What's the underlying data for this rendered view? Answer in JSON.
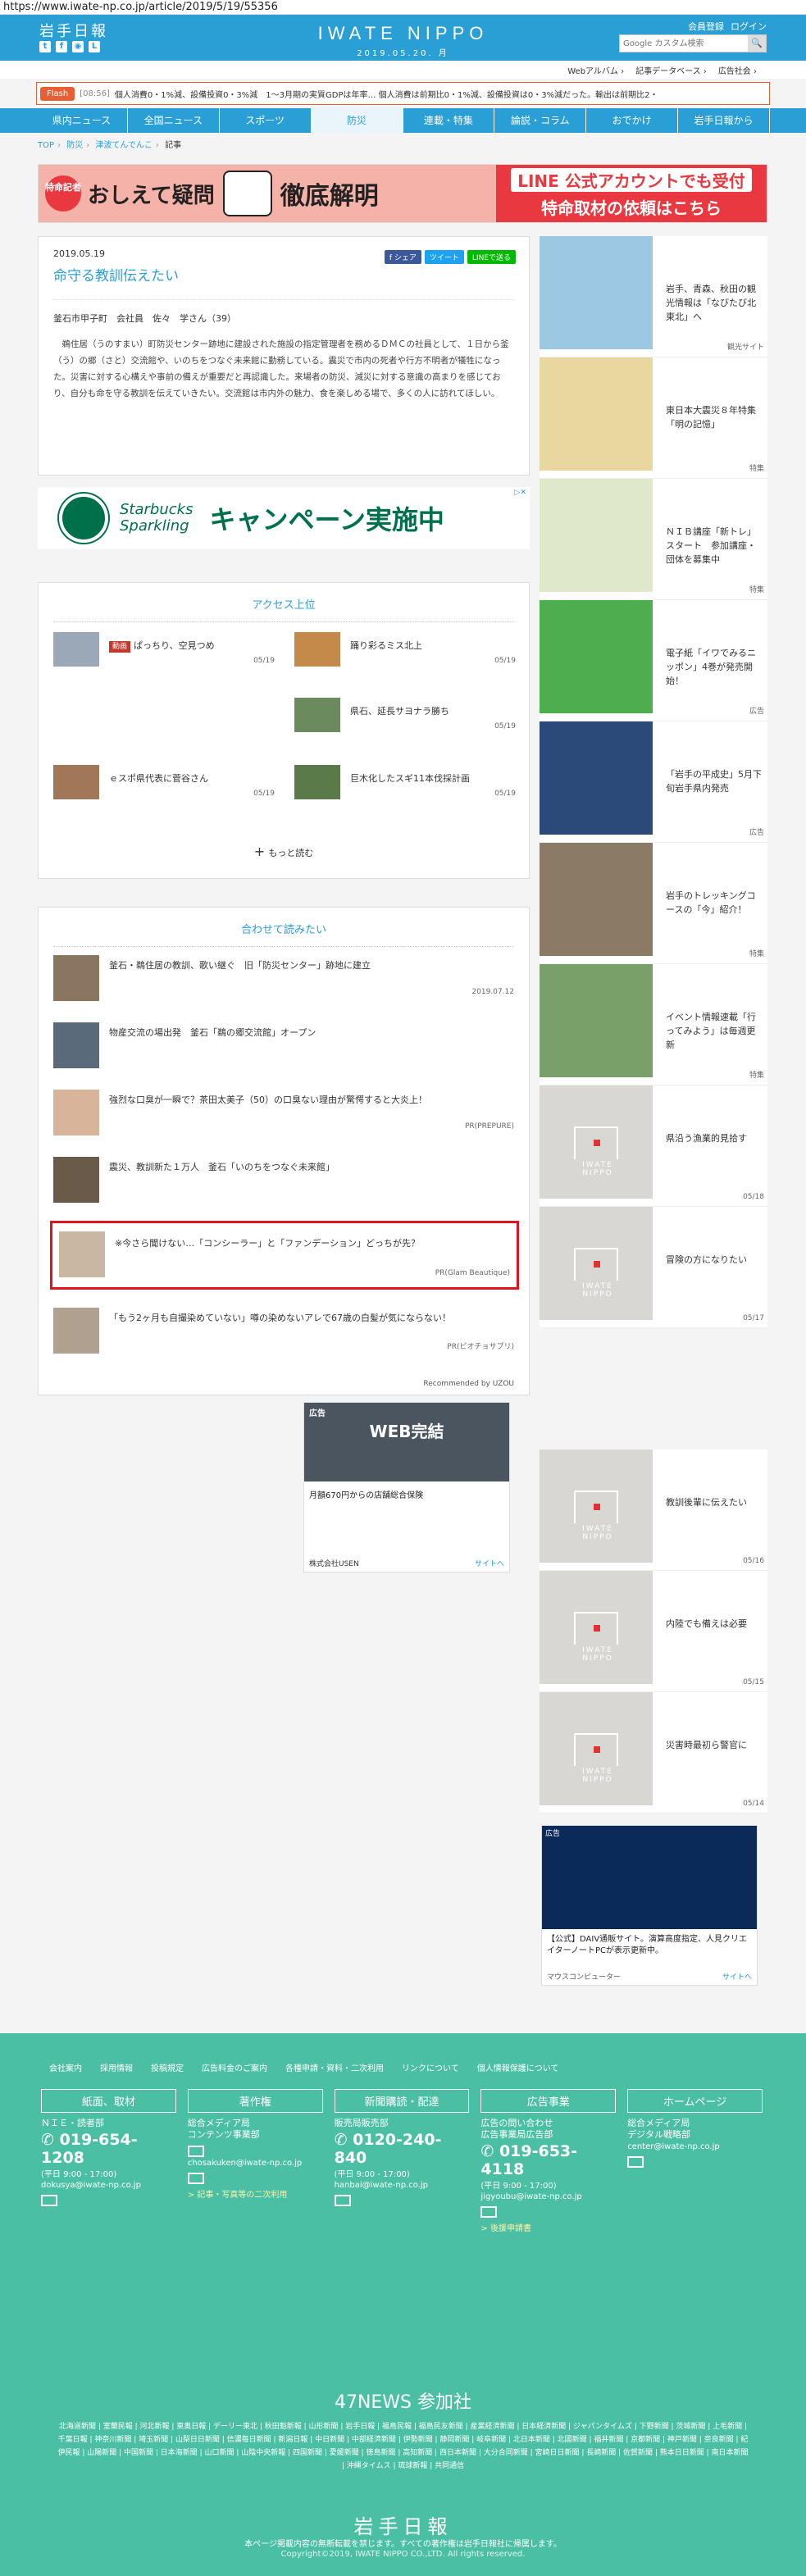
{
  "url": "https://www.iwate-np.co.jp/article/2019/5/19/55356",
  "header": {
    "logo_small": "岩手日報",
    "brand": "IWATE NIPPO",
    "date": "2019.05.20. 月",
    "register": "会員登録",
    "login": "ログイン",
    "search_placeholder": "Google カスタム検索",
    "search_button": "🔍",
    "sublinks": [
      "Webアルバム ›",
      "記事データベース ›",
      "広告社会 ›"
    ]
  },
  "flash": {
    "tag": "Flash",
    "time": "[08:56]",
    "text": "個人消費0・1%減、設備投資0・3%減　1〜3月期の実質GDPは年率… 個人消費は前期比0・1%減、設備投資は0・3%減だった。輸出は前期比2・"
  },
  "nav": [
    "県内ニュース",
    "全国ニュース",
    "スポーツ",
    "防災",
    "連載・特集",
    "論説・コラム",
    "おでかけ",
    "岩手日報から"
  ],
  "breadcrumb": [
    "TOP",
    "防災",
    "津波てんでんこ",
    "記事"
  ],
  "banner": {
    "badge": "特命記者",
    "left_title": "おしえて疑問",
    "right_title": "徹底解明",
    "line1": "LINE 公式アカウントでも受付",
    "line2": "特命取材の依頼はこちら"
  },
  "article": {
    "date": "2019.05.19",
    "title": "命守る教訓伝えたい",
    "share": [
      "f シェア",
      "ツイート",
      "LINEで送る"
    ],
    "byline": "釜石市甲子町　会社員　佐々　学さん（39）",
    "body": "　鵜住居（うのすまい）町防災センター跡地に建設された施設の指定管理者を務めるＤＭＣの社員として、１日から釜（う）の郷（さと）交流館や、いのちをつなぐ未来館に勤務している。震災で市内の死者や行方不明者が犠牲になった。災害に対する心構えや事前の備えが重要だと再認識した。来場者の防災、減災に対する意識の高まりを感じており、自分も命を守る教訓を伝えていきたい。交流館は市内外の魅力、食を楽しめる場で、多くの人に訪れてほしい。"
  },
  "starbucks_ad": {
    "brand1": "Starbucks",
    "brand2": "Sparkling",
    "headline": "キャンペーン実施中",
    "ad_icon": "▷✕"
  },
  "access": {
    "title": "アクセス上位",
    "items": [
      {
        "tag": "動画",
        "text": "ぱっちり、空見つめ",
        "date": "05/19"
      },
      {
        "tag": "",
        "text": "踊り彩るミス北上",
        "date": "05/19"
      },
      {
        "tag": "",
        "text": "県石、延長サヨナラ勝ち",
        "date": "05/19"
      },
      {
        "tag": "",
        "text": "ｅスポ県代表に菅谷さん",
        "date": "05/19"
      },
      {
        "tag": "",
        "text": "巨木化したスギ11本伐採計画",
        "date": "05/19"
      }
    ],
    "more": "もっと読む"
  },
  "related": {
    "title": "合わせて読みたい",
    "items": [
      {
        "text": "釜石・鵜住居の教訓、歌い継ぐ　旧「防災センター」跡地に建立",
        "src": "2019.07.12"
      },
      {
        "text": "物産交流の場出発　釜石「鵜の郷交流館」オープン",
        "src": ""
      },
      {
        "text": "強烈な口臭が一瞬で？茶田太美子（50）の口臭ない理由が驚愕すると大炎上！",
        "src": "PR(PREPURE)"
      },
      {
        "text": "震災、教訓新た１万人　釜石「いのちをつなぐ未来館」",
        "src": ""
      },
      {
        "text": "※今さら聞けない…「コンシーラー」と「ファンデーション」どっちが先？",
        "src": "PR(Glam Beautique)"
      },
      {
        "text": "「もう2ヶ月も自撮染めていない」噂の染めないアレで67歳の白髪が気にならない！",
        "src": "PR(ビオチョサプリ)"
      }
    ],
    "powered": "Recommended by UZOU"
  },
  "usen_ad": {
    "ad_label": "広告",
    "headline": "WEB完結",
    "caption": "月額670円からの店舗総合保険",
    "company": "株式会社USEN",
    "site": "サイトへ"
  },
  "side": [
    {
      "text": "岩手、青森、秋田の観光情報は「なびたび北東北」へ",
      "meta": "観光サイト"
    },
    {
      "text": "東日本大震災８年特集「明の記憶」",
      "meta": "特集"
    },
    {
      "text": "ＮＩＢ講座「新トレ」スタート　参加講座・団体を募集中",
      "meta": "特集"
    },
    {
      "text": "電子紙「イワでみるニッポン」4巻が発売開始！",
      "meta": "広告"
    },
    {
      "text": "「岩手の平成史」5月下旬岩手県内発売",
      "meta": "広告"
    },
    {
      "text": "岩手のトレッキングコースの「今」紹介！",
      "meta": "特集"
    },
    {
      "text": "イベント情報速載「行ってみよう」は毎週更新",
      "meta": "特集"
    },
    {
      "text": "県沿う漁業的見拾す",
      "meta": "05/18"
    },
    {
      "text": "冒険の方になりたい",
      "meta": "05/17"
    },
    {
      "text": "教訓後輩に伝えたい",
      "meta": "05/16"
    },
    {
      "text": "内陸でも備えは必要",
      "meta": "05/15"
    },
    {
      "text": "災害時最初ら警官に",
      "meta": "05/14"
    }
  ],
  "placeholder_logo": "IWATE NIPPO",
  "mouse_ad": {
    "ad_label": "広告",
    "caption": "【公式】DAIV通販サイト。演算高度指定、人見クリエイターノートPCが表示更新中。",
    "company": "マウスコンピューター",
    "site": "サイトへ"
  },
  "footer": {
    "links": [
      "会社案内",
      "採用情報",
      "投稿規定",
      "広告料金のご案内",
      "各種申請・資料・二次利用",
      "リンクについて",
      "個人情報保護について"
    ],
    "cols": [
      {
        "head": "紙面、取材",
        "sub": "ＮＩＥ・読者部",
        "phone": "019-654-1208",
        "hours": "(平日 9:00 - 17:00)",
        "mail": "dokusya@iwate-np.co.jp",
        "link": ""
      },
      {
        "head": "著作権",
        "sub": "総合メディア局\nコンテンツ事業部",
        "phone": "",
        "hours": "",
        "mail": "chosakuken@iwate-np.co.jp",
        "link": "> 記事・写真等の二次利用"
      },
      {
        "head": "新聞購読・配達",
        "sub": "販売局販売部",
        "phone": "0120-240-840",
        "hours": "(平日 9:00 - 17:00)",
        "mail": "hanbai@iwate-np.co.jp",
        "link": ""
      },
      {
        "head": "広告事業",
        "sub": "広告の問い合わせ\n広告事業局広告部",
        "phone": "019-653-4118",
        "hours": "(平日 9:00 - 17:00)",
        "mail": "jigyoubu@iwate-np.co.jp",
        "link": "> 後援申請書"
      },
      {
        "head": "ホームページ",
        "sub": "総合メディア局\nデジタル戦略部",
        "phone": "",
        "hours": "",
        "mail": "center@iwate-np.co.jp",
        "link": ""
      }
    ],
    "news47": "47NEWS 参加社",
    "papers": "北海道新聞 | 室蘭民報 | 河北新報 | 東奥日報 | デーリー東北 | 秋田魁新報 | 山形新聞 | 岩手日報 | 福島民報 | 福島民友新聞 | 産業経済新聞 | 日本経済新聞 | ジャパンタイムズ | 下野新聞 | 茨城新聞 | 上毛新聞 | 千葉日報 | 神奈川新聞 | 埼玉新聞 | 山梨日日新聞 | 信濃毎日新聞 | 新潟日報 | 中日新聞 | 中部経済新聞 | 伊勢新聞 | 静岡新聞 | 岐阜新聞 | 北日本新聞 | 北國新聞 | 福井新聞 | 京都新聞 | 神戸新聞 | 奈良新聞 | 紀伊民報 | 山陽新聞 | 中国新聞 | 日本海新聞 | 山口新聞 | 山陰中央新報 | 四国新聞 | 愛媛新聞 | 徳島新聞 | 高知新聞 | 西日本新聞 | 大分合同新聞 | 宮崎日日新聞 | 長崎新聞 | 佐賀新聞 | 熊本日日新聞 | 南日本新聞 | 沖縄タイムス | 琉球新報 | 共同通信",
    "logo": "岩手日報",
    "note": "本ページ掲載内容の無断転載を禁じます。すべての著作権は岩手日報社に帰属します。",
    "copy": "Copyright©2019, IWATE NIPPO CO.,LTD. All rights reserved."
  }
}
